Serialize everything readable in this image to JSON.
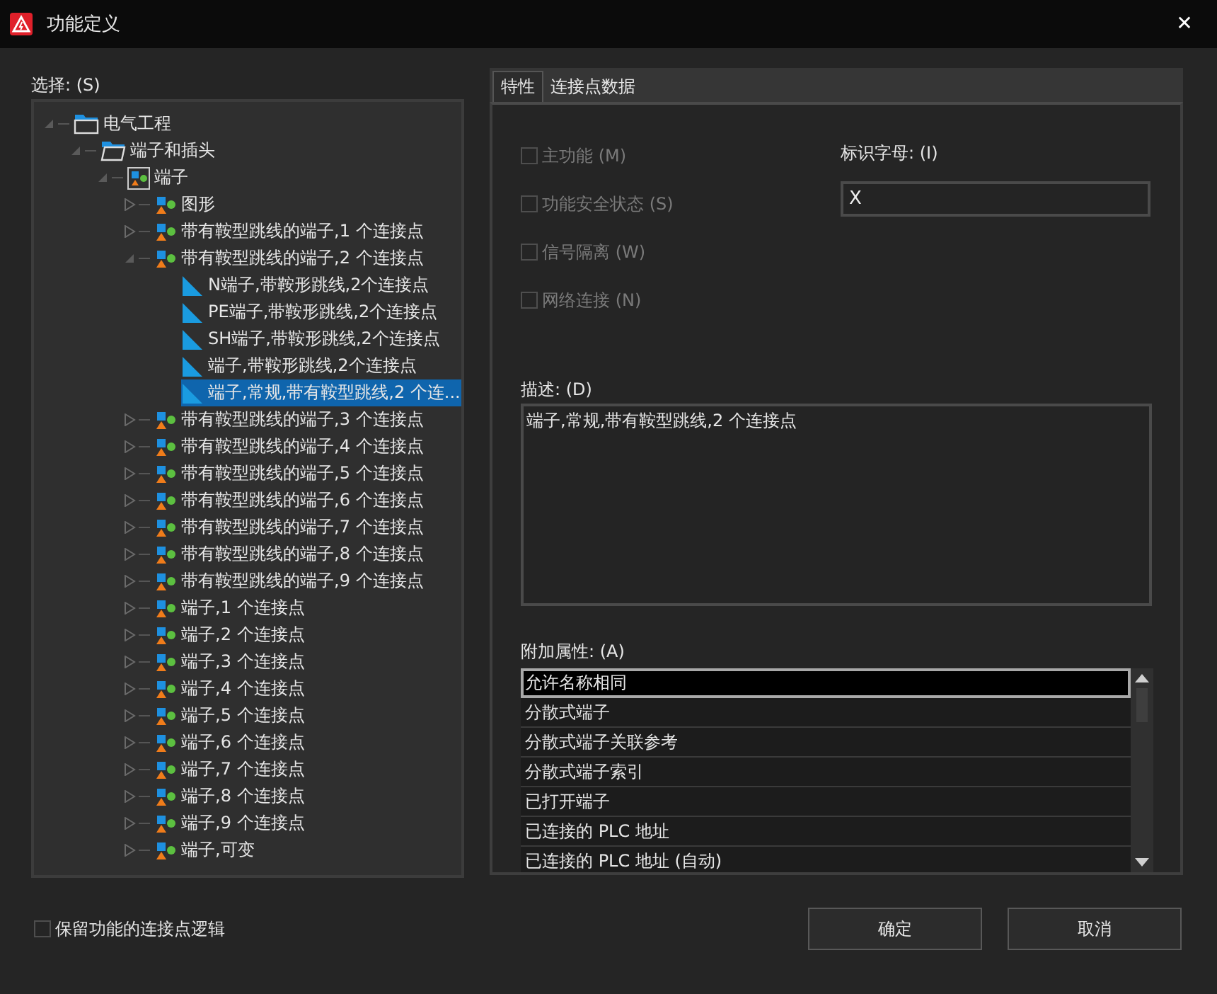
{
  "window": {
    "title": "功能定义",
    "close": "✕"
  },
  "tree": {
    "label": "选择: (S)",
    "items": [
      {
        "kind": "folder",
        "label": "电气工程",
        "expanded": true,
        "selected": false,
        "children": [
          {
            "kind": "folder-open",
            "label": "端子和插头",
            "expanded": true,
            "selected": false,
            "children": [
              {
                "kind": "category",
                "label": "端子",
                "expanded": true,
                "selected": false,
                "children": [
                  {
                    "kind": "function",
                    "label": "图形",
                    "expanded": false,
                    "selected": false
                  },
                  {
                    "kind": "function",
                    "label": "带有鞍型跳线的端子,1 个连接点",
                    "expanded": false,
                    "selected": false
                  },
                  {
                    "kind": "function",
                    "label": "带有鞍型跳线的端子,2 个连接点",
                    "expanded": true,
                    "selected": false,
                    "children": [
                      {
                        "kind": "variant",
                        "label": "N端子,带鞍形跳线,2个连接点",
                        "selected": false
                      },
                      {
                        "kind": "variant",
                        "label": "PE端子,带鞍形跳线,2个连接点",
                        "selected": false
                      },
                      {
                        "kind": "variant",
                        "label": "SH端子,带鞍形跳线,2个连接点",
                        "selected": false
                      },
                      {
                        "kind": "variant",
                        "label": "端子,带鞍形跳线,2个连接点",
                        "selected": false
                      },
                      {
                        "kind": "variant",
                        "label": "端子,常规,带有鞍型跳线,2 个连...",
                        "selected": true
                      }
                    ]
                  },
                  {
                    "kind": "function",
                    "label": "带有鞍型跳线的端子,3 个连接点",
                    "expanded": false,
                    "selected": false
                  },
                  {
                    "kind": "function",
                    "label": "带有鞍型跳线的端子,4 个连接点",
                    "expanded": false,
                    "selected": false
                  },
                  {
                    "kind": "function",
                    "label": "带有鞍型跳线的端子,5 个连接点",
                    "expanded": false,
                    "selected": false
                  },
                  {
                    "kind": "function",
                    "label": "带有鞍型跳线的端子,6 个连接点",
                    "expanded": false,
                    "selected": false
                  },
                  {
                    "kind": "function",
                    "label": "带有鞍型跳线的端子,7 个连接点",
                    "expanded": false,
                    "selected": false
                  },
                  {
                    "kind": "function",
                    "label": "带有鞍型跳线的端子,8 个连接点",
                    "expanded": false,
                    "selected": false
                  },
                  {
                    "kind": "function",
                    "label": "带有鞍型跳线的端子,9 个连接点",
                    "expanded": false,
                    "selected": false
                  },
                  {
                    "kind": "function",
                    "label": "端子,1 个连接点",
                    "expanded": false,
                    "selected": false
                  },
                  {
                    "kind": "function",
                    "label": "端子,2 个连接点",
                    "expanded": false,
                    "selected": false
                  },
                  {
                    "kind": "function",
                    "label": "端子,3 个连接点",
                    "expanded": false,
                    "selected": false
                  },
                  {
                    "kind": "function",
                    "label": "端子,4 个连接点",
                    "expanded": false,
                    "selected": false
                  },
                  {
                    "kind": "function",
                    "label": "端子,5 个连接点",
                    "expanded": false,
                    "selected": false
                  },
                  {
                    "kind": "function",
                    "label": "端子,6 个连接点",
                    "expanded": false,
                    "selected": false
                  },
                  {
                    "kind": "function",
                    "label": "端子,7 个连接点",
                    "expanded": false,
                    "selected": false
                  },
                  {
                    "kind": "function",
                    "label": "端子,8 个连接点",
                    "expanded": false,
                    "selected": false
                  },
                  {
                    "kind": "function",
                    "label": "端子,9 个连接点",
                    "expanded": false,
                    "selected": false
                  },
                  {
                    "kind": "function",
                    "label": "端子,可变",
                    "expanded": false,
                    "selected": false
                  }
                ]
              }
            ]
          }
        ]
      }
    ]
  },
  "tabs": [
    {
      "label": "特性",
      "selected": true
    },
    {
      "label": "连接点数据",
      "selected": false
    }
  ],
  "options": [
    {
      "label": "主功能 (M)",
      "checked": false,
      "disabled": true
    },
    {
      "label": "功能安全状态 (S)",
      "checked": false,
      "disabled": true
    },
    {
      "label": "信号隔离 (W)",
      "checked": false,
      "disabled": true
    },
    {
      "label": "网络连接 (N)",
      "checked": false,
      "disabled": true
    }
  ],
  "identifier": {
    "label": "标识字母: (I)",
    "value": "X"
  },
  "description": {
    "label": "描述: (D)",
    "value": "端子,常规,带有鞍型跳线,2 个连接点"
  },
  "attributes": {
    "label": "附加属性: (A)",
    "items": [
      {
        "label": "允许名称相同",
        "selected": true
      },
      {
        "label": "分散式端子",
        "selected": false
      },
      {
        "label": "分散式端子关联参考",
        "selected": false
      },
      {
        "label": "分散式端子索引",
        "selected": false
      },
      {
        "label": "已打开端子",
        "selected": false
      },
      {
        "label": "已连接的 PLC 地址",
        "selected": false
      },
      {
        "label": "已连接的 PLC 地址 (自动)",
        "selected": false
      }
    ]
  },
  "keep_logic": {
    "label": "保留功能的连接点逻辑",
    "checked": false
  },
  "buttons": [
    "确定",
    "取消"
  ]
}
